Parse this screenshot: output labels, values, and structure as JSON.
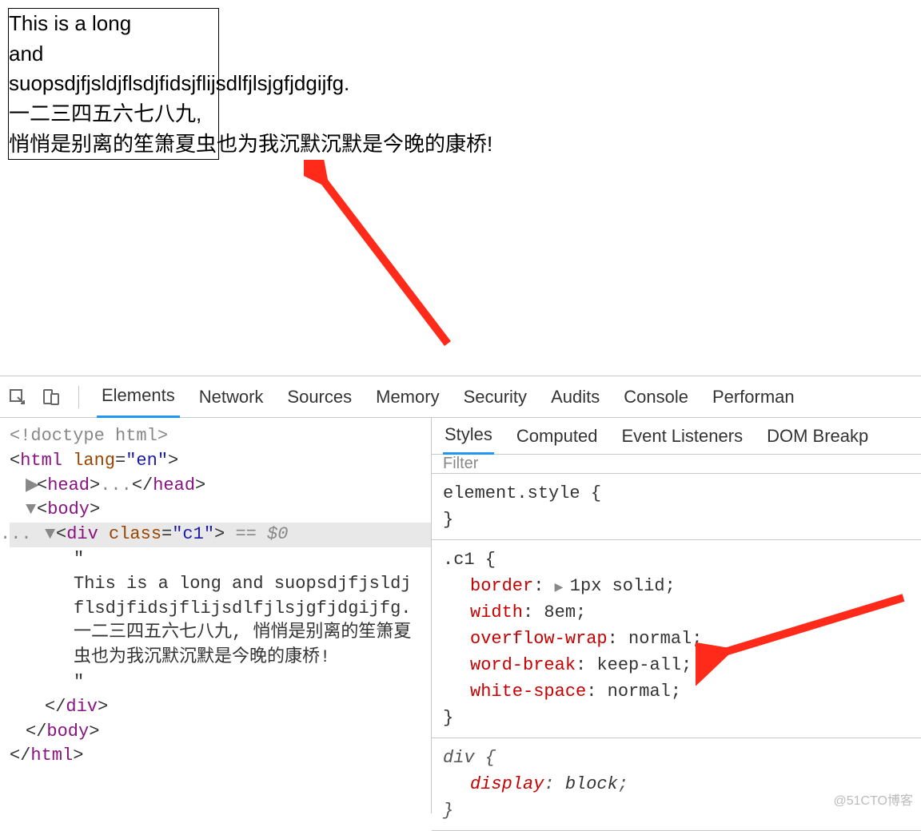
{
  "page": {
    "box_text_line1": "This is a long",
    "box_text_line2": "and",
    "box_text_line3": "suopsdjfjsldjflsdjfidsjflijsdlfjlsjgfjdgijfg.",
    "box_text_line4": "一二三四五六七八九,",
    "box_text_line5": "悄悄是别离的笙箫夏虫也为我沉默沉默是今晚的康桥!"
  },
  "devtools": {
    "tabs": [
      "Elements",
      "Network",
      "Sources",
      "Memory",
      "Security",
      "Audits",
      "Console",
      "Performan"
    ],
    "active_tab": "Elements",
    "sub_tabs": [
      "Styles",
      "Computed",
      "Event Listeners",
      "DOM Breakp"
    ],
    "active_sub_tab": "Styles",
    "filter_placeholder": "Filter"
  },
  "dom": {
    "doctype": "<!doctype html>",
    "html_open_tag": "html",
    "html_lang_attr": "lang",
    "html_lang_val": "\"en\"",
    "head_tag": "head",
    "head_ellipsis": "...",
    "body_tag": "body",
    "div_tag": "div",
    "div_class_attr": "class",
    "div_class_val": "\"c1\"",
    "eq_zero": "== $0",
    "text_content": "This is a long and suopsdjfjsldjflsdjfidsjflijsdlfjlsjgfjdgijfg. 一二三四五六七八九, 悄悄是别离的笙箫夏虫也为我沉默沉默是今晚的康桥!",
    "quote": "\""
  },
  "styles": {
    "element_style_sel": "element.style {",
    "c1_sel": ".c1 {",
    "c1_rules": [
      {
        "prop": "border",
        "val": "1px solid",
        "tri": true
      },
      {
        "prop": "width",
        "val": "8em"
      },
      {
        "prop": "overflow-wrap",
        "val": "normal"
      },
      {
        "prop": "word-break",
        "val": "keep-all"
      },
      {
        "prop": "white-space",
        "val": "normal"
      }
    ],
    "div_sel": "div {",
    "div_rules": [
      {
        "prop": "display",
        "val": "block"
      }
    ],
    "close_brace": "}"
  },
  "watermark": "@51CTO博客"
}
